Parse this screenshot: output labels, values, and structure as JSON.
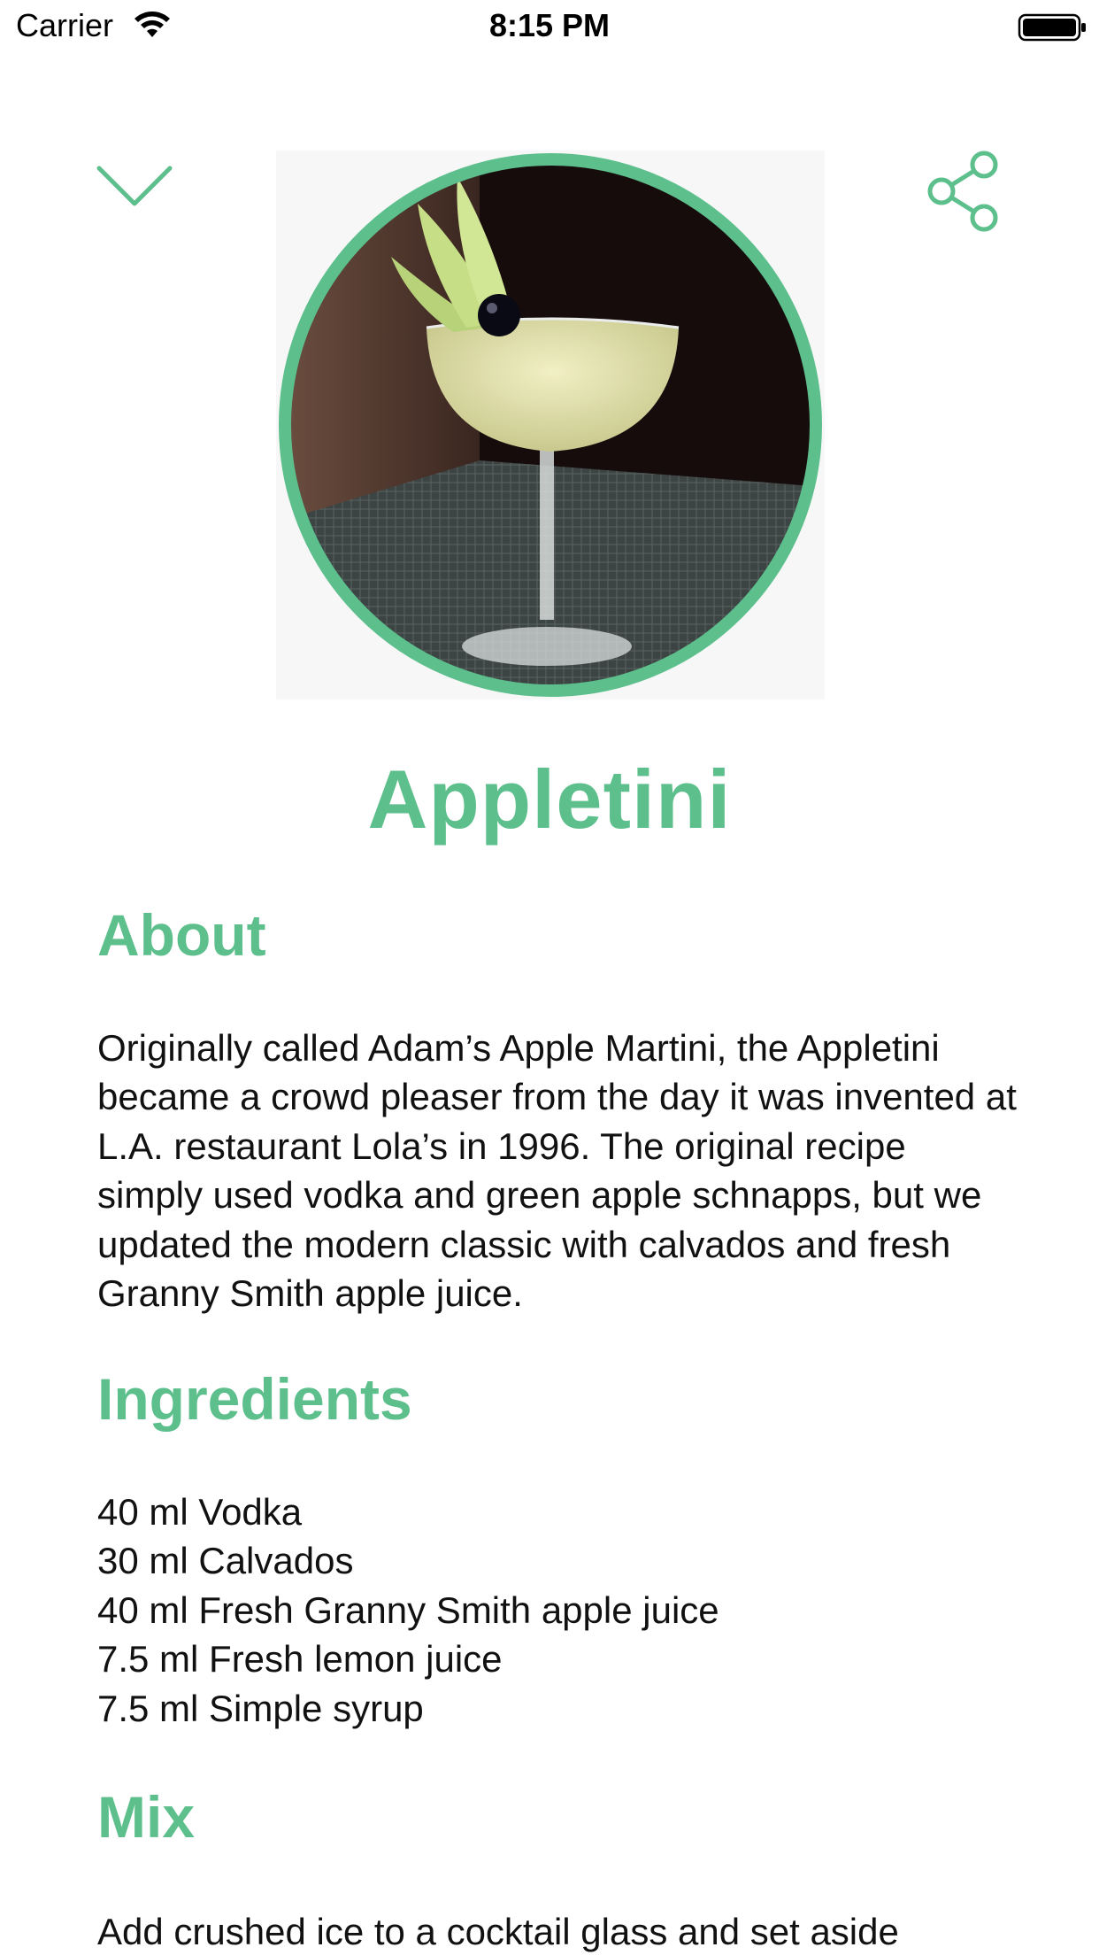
{
  "status_bar": {
    "carrier": "Carrier",
    "time": "8:15 PM"
  },
  "colors": {
    "accent": "#5cbf8c",
    "text": "#111111",
    "background": "#ffffff"
  },
  "icons": {
    "dismiss": "chevron-down-icon",
    "share": "share-icon"
  },
  "recipe": {
    "title": "Appletini",
    "about_heading": "About",
    "about_text": "Originally called Adam’s Apple Martini, the Appletini became a crowd pleaser from the day it was invented at L.A. restaurant Lola’s in 1996. The original recipe simply used vodka and green apple schnapps, but we updated the modern classic with calvados and fresh Granny Smith apple juice.",
    "ingredients_heading": "Ingredients",
    "ingredients": [
      "40 ml Vodka",
      "30 ml Calvados",
      "40 ml Fresh Granny Smith apple juice",
      "7.5 ml Fresh lemon juice",
      "7.5 ml Simple syrup"
    ],
    "mix_heading": "Mix",
    "mix_text": "Add crushed ice to a cocktail glass and set aside"
  }
}
